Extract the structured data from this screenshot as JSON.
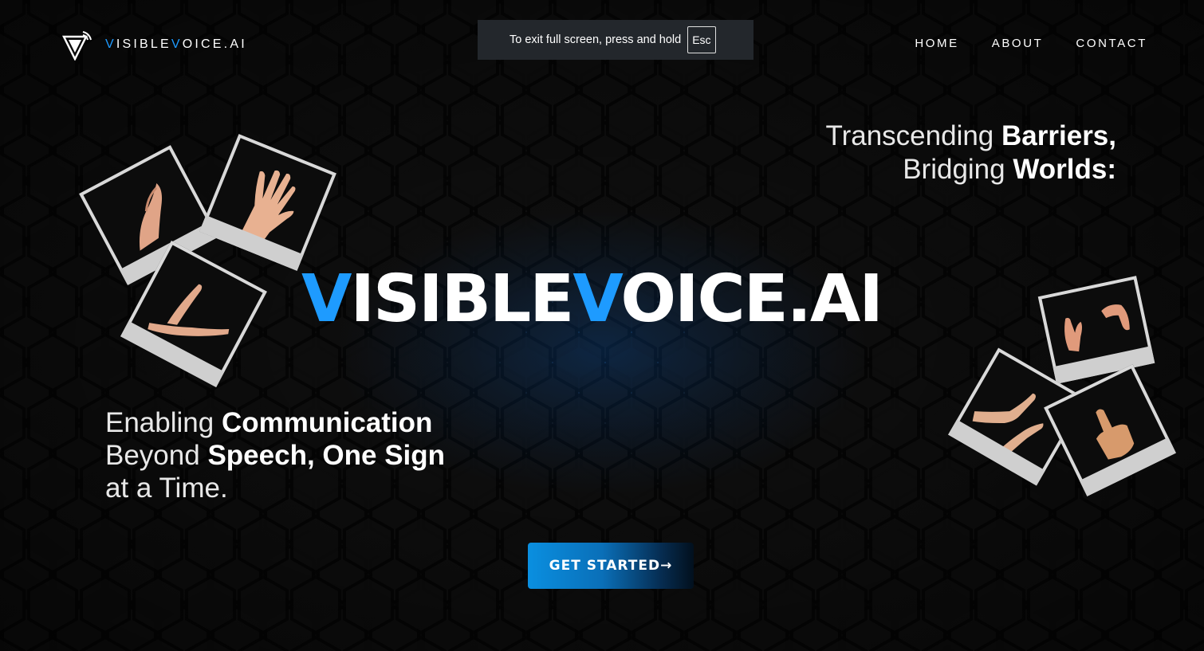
{
  "brand": {
    "name_first_letter": "V",
    "name_part1": "ISIBLE",
    "name_second_letter": "V",
    "name_part2": "OICE.AI",
    "accent_color": "#1e9bff"
  },
  "nav": {
    "items": [
      {
        "label": "HOME"
      },
      {
        "label": "ABOUT"
      },
      {
        "label": "CONTACT"
      }
    ]
  },
  "fullscreen_toast": {
    "message": "To exit full screen, press and hold",
    "key": "Esc"
  },
  "tagline_right": {
    "line1_thin": "Transcending",
    "line1_bold": "Barriers,",
    "line2_thin": "Bridging",
    "line2_bold": "Worlds:"
  },
  "hero": {
    "v1": "V",
    "part1": "ISIBLE",
    "v2": "V",
    "part2": "OICE.AI"
  },
  "tagline_left": {
    "line1_thin": "Enabling",
    "line1_bold": "Communication",
    "line2_thin": "Beyond",
    "line2_bold": "Speech, One Sign",
    "line3_thin": "at a Time."
  },
  "cta": {
    "label": "GET STARTED→"
  },
  "icons": {
    "logo": "triangle-signal-logo-icon",
    "photos": [
      "hand-sign-photo",
      "open-hand-photo",
      "cupped-hands-photo",
      "claw-hands-photo",
      "pointing-hands-photo",
      "thumbs-up-photo"
    ]
  }
}
